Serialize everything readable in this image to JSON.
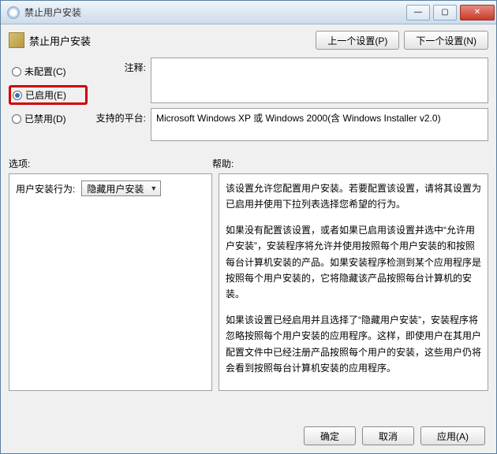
{
  "window": {
    "title": "禁止用户安装"
  },
  "header": {
    "title": "禁止用户安装",
    "prev_btn": "上一个设置(P)",
    "next_btn": "下一个设置(N)"
  },
  "radios": {
    "not_configured": "未配置(C)",
    "enabled": "已启用(E)",
    "disabled": "已禁用(D)"
  },
  "fields": {
    "comment_label": "注释:",
    "platform_label": "支持的平台:",
    "platform_value": "Microsoft Windows XP 或 Windows 2000(含 Windows Installer v2.0)"
  },
  "mid": {
    "options_label": "选项:",
    "help_label": "帮助:"
  },
  "options": {
    "behavior_label": "用户安装行为:",
    "behavior_value": "隐藏用户安装"
  },
  "help": {
    "p1": "该设置允许您配置用户安装。若要配置该设置，请将其设置为已启用并使用下拉列表选择您希望的行为。",
    "p2": "如果没有配置该设置，或者如果已启用该设置并选中“允许用户安装”，安装程序将允许并使用按照每个用户安装的和按照每台计算机安装的产品。如果安装程序检测到某个应用程序是按照每个用户安装的，它将隐藏该产品按照每台计算机的安装。",
    "p3": "如果该设置已经启用并且选择了“隐藏用户安装”，安装程序将忽略按照每个用户安装的应用程序。这样，即使用户在其用户配置文件中已经注册产品按照每个用户的安装，这些用户仍将会看到按照每台计算机安装的应用程序。"
  },
  "buttons": {
    "ok": "确定",
    "cancel": "取消",
    "apply": "应用(A)"
  }
}
